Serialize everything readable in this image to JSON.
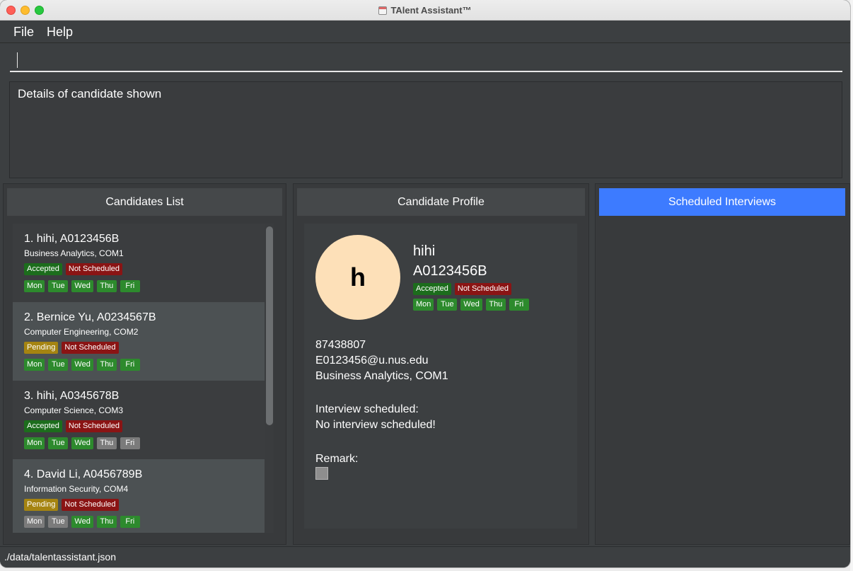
{
  "window": {
    "title": "TAlent Assistant™"
  },
  "menu": {
    "file": "File",
    "help": "Help"
  },
  "command": {
    "value": "",
    "placeholder": ""
  },
  "result": {
    "text": "Details of candidate shown"
  },
  "panels": {
    "list_title": "Candidates List",
    "profile_title": "Candidate Profile",
    "interviews_title": "Scheduled Interviews"
  },
  "candidates": [
    {
      "name": "1.  hihi, A0123456B",
      "course": "Business Analytics, COM1",
      "status": "Accepted",
      "interview": "Not Scheduled",
      "days": [
        {
          "label": "Mon",
          "available": true
        },
        {
          "label": "Tue",
          "available": true
        },
        {
          "label": "Wed",
          "available": true
        },
        {
          "label": "Thu",
          "available": true
        },
        {
          "label": "Fri",
          "available": true
        }
      ]
    },
    {
      "name": "2.  Bernice Yu, A0234567B",
      "course": "Computer Engineering, COM2",
      "status": "Pending",
      "interview": "Not Scheduled",
      "days": [
        {
          "label": "Mon",
          "available": true
        },
        {
          "label": "Tue",
          "available": true
        },
        {
          "label": "Wed",
          "available": true
        },
        {
          "label": "Thu",
          "available": true
        },
        {
          "label": "Fri",
          "available": true
        }
      ]
    },
    {
      "name": "3.  hihi, A0345678B",
      "course": "Computer Science, COM3",
      "status": "Accepted",
      "interview": "Not Scheduled",
      "days": [
        {
          "label": "Mon",
          "available": true
        },
        {
          "label": "Tue",
          "available": true
        },
        {
          "label": "Wed",
          "available": true
        },
        {
          "label": "Thu",
          "available": false
        },
        {
          "label": "Fri",
          "available": false
        }
      ]
    },
    {
      "name": "4.  David Li, A0456789B",
      "course": "Information Security, COM4",
      "status": "Pending",
      "interview": "Not Scheduled",
      "days": [
        {
          "label": "Mon",
          "available": false
        },
        {
          "label": "Tue",
          "available": false
        },
        {
          "label": "Wed",
          "available": true
        },
        {
          "label": "Thu",
          "available": true
        },
        {
          "label": "Fri",
          "available": true
        }
      ]
    }
  ],
  "profile": {
    "avatar_letter": "h",
    "name": "hihi",
    "student_id": "A0123456B",
    "status": "Accepted",
    "interview": "Not Scheduled",
    "days": [
      {
        "label": "Mon",
        "available": true
      },
      {
        "label": "Tue",
        "available": true
      },
      {
        "label": "Wed",
        "available": true
      },
      {
        "label": "Thu",
        "available": true
      },
      {
        "label": "Fri",
        "available": true
      }
    ],
    "phone": "87438807",
    "email": "E0123456@u.nus.edu",
    "course": "Business Analytics, COM1",
    "interview_label": "Interview scheduled:",
    "interview_value": "No interview scheduled!",
    "remark_label": "Remark:"
  },
  "status_bar": {
    "path": "./data/talentassistant.json"
  },
  "colors": {
    "accent": "#3d7bff",
    "accepted": "#1c6d1c",
    "pending": "#a58411",
    "not_scheduled": "#8a1414",
    "day_available": "#2d8a2d",
    "day_unavailable": "#7b7b7b"
  },
  "icons": {
    "app": "calendar-icon"
  }
}
